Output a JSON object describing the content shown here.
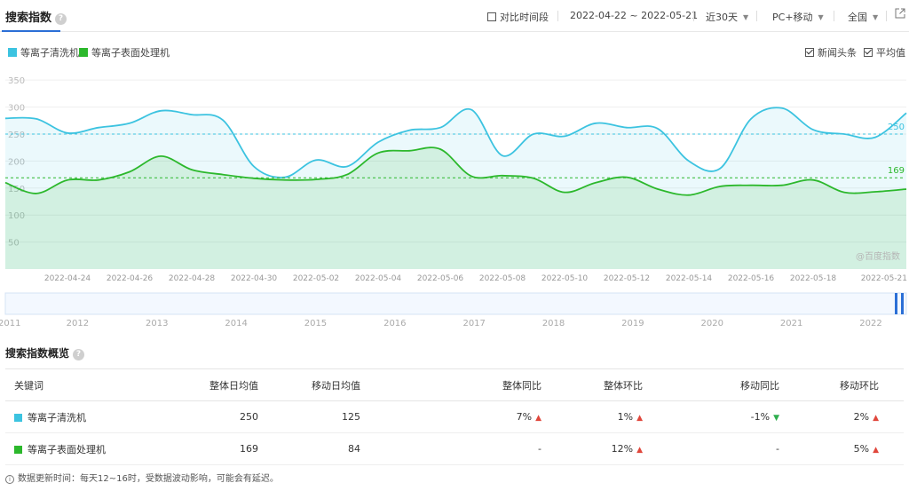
{
  "header": {
    "title": "搜索指数",
    "compare_label": "对比时间段",
    "date_range": "2022-04-22 ~ 2022-05-21",
    "period": "近30天",
    "device": "PC+移动",
    "region": "全国"
  },
  "legend": {
    "news_label": "新闻头条",
    "avg_label": "平均值"
  },
  "chart_data": {
    "type": "area",
    "x": [
      "2022-04-22",
      "2022-04-23",
      "2022-04-24",
      "2022-04-25",
      "2022-04-26",
      "2022-04-27",
      "2022-04-28",
      "2022-04-29",
      "2022-04-30",
      "2022-05-01",
      "2022-05-02",
      "2022-05-03",
      "2022-05-04",
      "2022-05-05",
      "2022-05-06",
      "2022-05-07",
      "2022-05-08",
      "2022-05-09",
      "2022-05-10",
      "2022-05-11",
      "2022-05-12",
      "2022-05-13",
      "2022-05-14",
      "2022-05-15",
      "2022-05-16",
      "2022-05-17",
      "2022-05-18",
      "2022-05-19",
      "2022-05-20",
      "2022-05-21"
    ],
    "x_tick_labels": [
      "2022-04-24",
      "2022-04-26",
      "2022-04-28",
      "2022-04-30",
      "2022-05-02",
      "2022-05-04",
      "2022-05-06",
      "2022-05-08",
      "2022-05-10",
      "2022-05-12",
      "2022-05-14",
      "2022-05-16",
      "2022-05-18",
      "2022-05-21"
    ],
    "y_ticks": [
      50,
      100,
      150,
      200,
      250,
      300,
      350
    ],
    "ylim": [
      0,
      370
    ],
    "series": [
      {
        "name": "等离子清洗机",
        "color": "#3cc3e0",
        "average": 250,
        "average_label": "250",
        "values": [
          279,
          278,
          252,
          262,
          270,
          293,
          286,
          276,
          190,
          170,
          202,
          190,
          235,
          257,
          262,
          295,
          210,
          250,
          246,
          270,
          262,
          260,
          200,
          186,
          278,
          298,
          258,
          250,
          244,
          289
        ]
      },
      {
        "name": "等离子表面处理机",
        "color": "#2cb82c",
        "average": 169,
        "average_label": "169",
        "values": [
          160,
          140,
          165,
          165,
          180,
          209,
          184,
          175,
          168,
          165,
          166,
          175,
          215,
          219,
          222,
          172,
          173,
          168,
          142,
          160,
          170,
          148,
          137,
          153,
          155,
          155,
          165,
          142,
          143,
          148
        ]
      }
    ],
    "watermark": "@百度指数",
    "overview_years": [
      "2011",
      "2012",
      "2013",
      "2014",
      "2015",
      "2016",
      "2017",
      "2018",
      "2019",
      "2020",
      "2021",
      "2022"
    ],
    "grid": true,
    "legend_position": "top-left"
  },
  "overview": {
    "title": "搜索指数概览",
    "columns": [
      "关键词",
      "整体日均值",
      "移动日均值",
      "整体同比",
      "整体环比",
      "移动同比",
      "移动环比"
    ],
    "rows": [
      {
        "keyword": "等离子清洗机",
        "color": "#3cc3e0",
        "overall_avg": "250",
        "mobile_avg": "125",
        "overall_yoy": "7%",
        "overall_yoy_dir": "up",
        "overall_mom": "1%",
        "overall_mom_dir": "up",
        "mobile_yoy": "-1%",
        "mobile_yoy_dir": "down",
        "mobile_mom": "2%",
        "mobile_mom_dir": "up"
      },
      {
        "keyword": "等离子表面处理机",
        "color": "#2cb82c",
        "overall_avg": "169",
        "mobile_avg": "84",
        "overall_yoy": "-",
        "overall_yoy_dir": "",
        "overall_mom": "12%",
        "overall_mom_dir": "up",
        "mobile_yoy": "-",
        "mobile_yoy_dir": "",
        "mobile_mom": "5%",
        "mobile_mom_dir": "up"
      }
    ]
  },
  "footer_note": "数据更新时间：每天12~16时，受数据波动影响，可能会有延迟。"
}
